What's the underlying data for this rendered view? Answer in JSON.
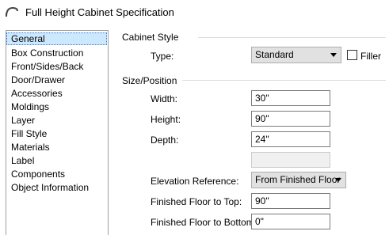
{
  "window": {
    "title": "Full Height Cabinet Specification"
  },
  "sidebar": {
    "items": [
      {
        "label": "General",
        "selected": true
      },
      {
        "label": "Box Construction"
      },
      {
        "label": "Front/Sides/Back"
      },
      {
        "label": "Door/Drawer"
      },
      {
        "label": "Accessories"
      },
      {
        "label": "Moldings"
      },
      {
        "label": "Layer"
      },
      {
        "label": "Fill Style"
      },
      {
        "label": "Materials"
      },
      {
        "label": "Label"
      },
      {
        "label": "Components"
      },
      {
        "label": "Object Information"
      }
    ]
  },
  "cabinet_style": {
    "group_label": "Cabinet Style",
    "type_label": "Type:",
    "type_value": "Standard",
    "filler_label": "Filler",
    "filler_checked": false
  },
  "size_position": {
    "group_label": "Size/Position",
    "width_label": "Width:",
    "width_value": "30\"",
    "height_label": "Height:",
    "height_value": "90\"",
    "depth_label": "Depth:",
    "depth_value": "24\"",
    "extra_value": "",
    "elevation_label": "Elevation Reference:",
    "elevation_value": "From Finished Floor",
    "floor_top_label": "Finished Floor to Top:",
    "floor_top_value": "90\"",
    "floor_bottom_label": "Finished Floor to Bottom:",
    "floor_bottom_value": "0\""
  }
}
